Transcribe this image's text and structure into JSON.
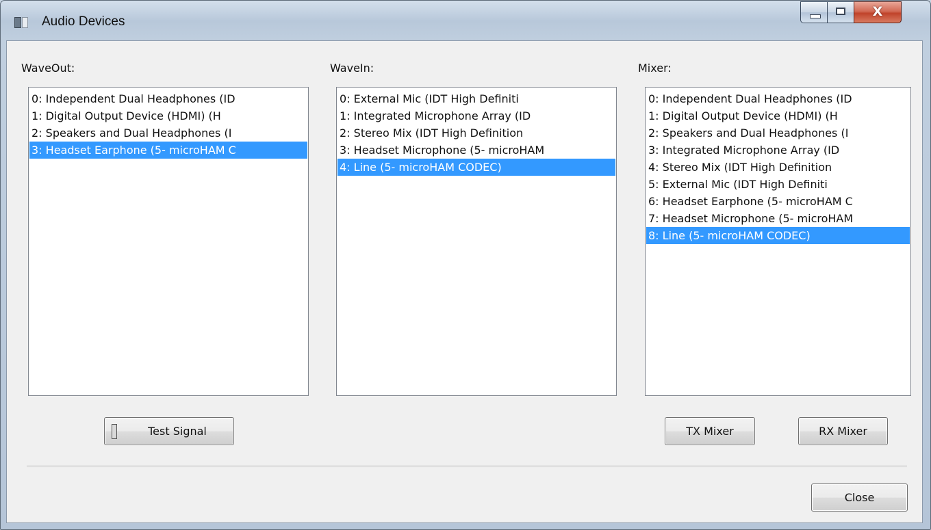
{
  "window": {
    "title": "Audio Devices",
    "minimize_glyph": "",
    "maximize_glyph": "",
    "close_glyph": "X"
  },
  "waveout": {
    "label": "WaveOut:",
    "items": [
      "0: Independent Dual Headphones (ID",
      "1: Digital Output Device (HDMI) (H",
      "2: Speakers and Dual Headphones (I",
      "3: Headset Earphone (5- microHAM C"
    ],
    "selected_index": 3
  },
  "wavein": {
    "label": "WaveIn:",
    "items": [
      "0: External Mic (IDT High Definiti",
      "1: Integrated Microphone Array (ID",
      "2: Stereo Mix (IDT High Definition",
      "3: Headset Microphone (5- microHAM",
      "4: Line (5- microHAM CODEC)"
    ],
    "selected_index": 4
  },
  "mixer": {
    "label": "Mixer:",
    "items": [
      "0: Independent Dual Headphones (ID",
      "1: Digital Output Device (HDMI) (H",
      "2: Speakers and Dual Headphones (I",
      "3: Integrated Microphone Array (ID",
      "4: Stereo Mix (IDT High Definition",
      "5: External Mic (IDT High Definiti",
      "6: Headset Earphone (5- microHAM C",
      "7: Headset Microphone (5- microHAM",
      "8: Line (5- microHAM CODEC)"
    ],
    "selected_index": 8
  },
  "buttons": {
    "test_signal": "Test Signal",
    "tx_mixer": "TX Mixer",
    "rx_mixer": "RX Mixer",
    "close": "Close"
  },
  "colors": {
    "selection": "#3399ff",
    "client_bg": "#f0f0f0"
  },
  "icons": {
    "app": "audio-devices-app-icon",
    "led": "test-signal-indicator"
  }
}
